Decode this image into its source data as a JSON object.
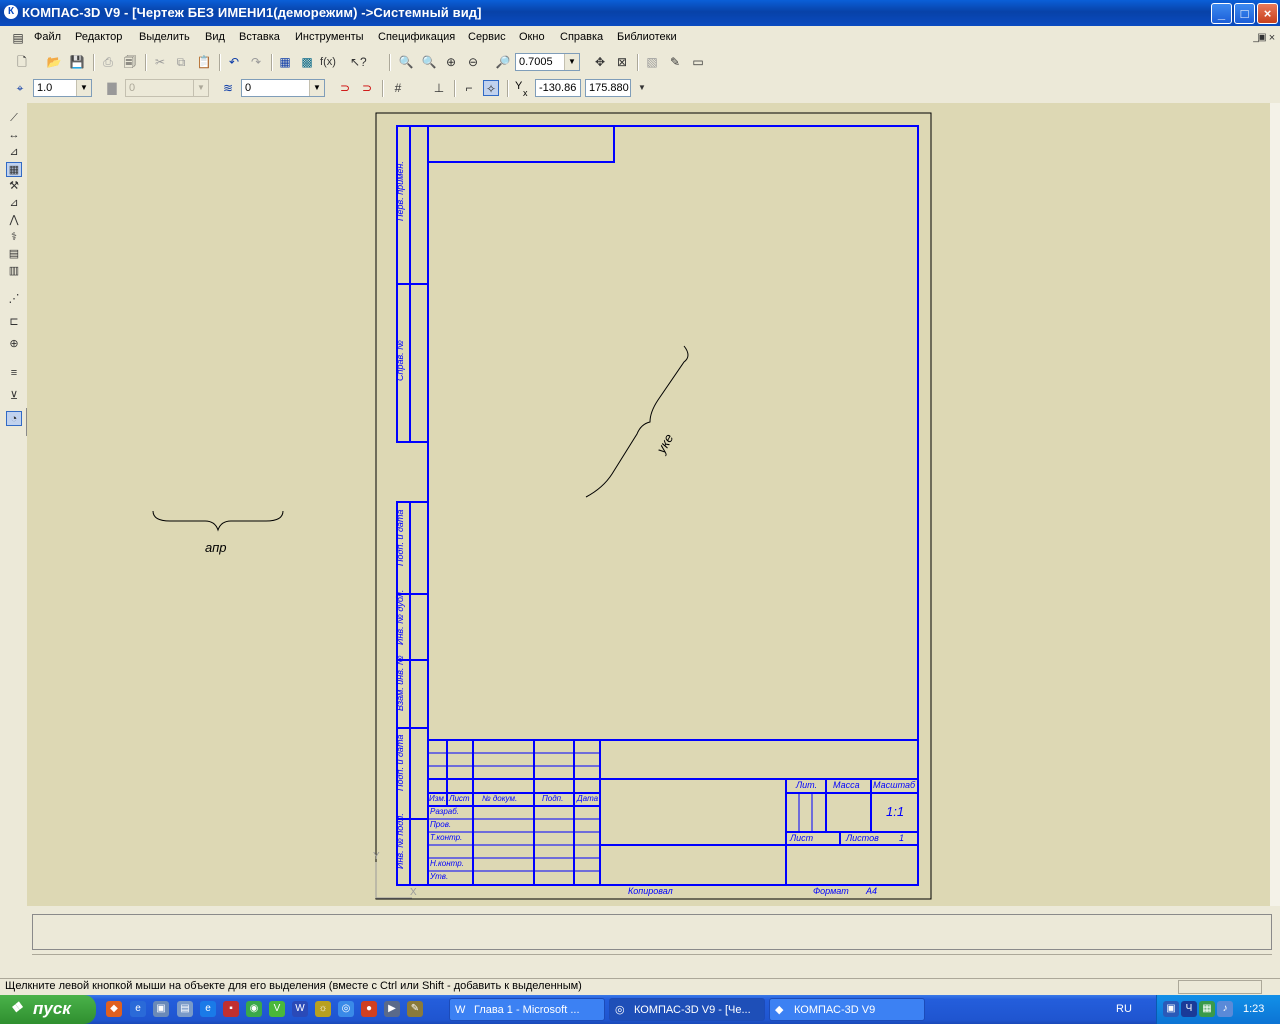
{
  "window": {
    "title": "КОМПАС-3D V9 - [Чертеж БЕЗ ИМЕНИ1(деморежим) ->Системный вид]",
    "controls": [
      "_",
      "□",
      "×"
    ]
  },
  "menu": [
    "Файл",
    "Редактор",
    "Выделить",
    "Вид",
    "Вставка",
    "Инструменты",
    "Спецификация",
    "Сервис",
    "Окно",
    "Справка",
    "Библиотеки"
  ],
  "toolbar1": {
    "zoom_value": "0.7005",
    "fx_label": "f(x)"
  },
  "toolbar2": {
    "step_value": "1.0",
    "layer_disabled_value": "0",
    "style_value": "0",
    "coord_y_label": "Y",
    "coord_x_label": "x",
    "coord_x_value": "-130.86",
    "coord_y_value": "175.880"
  },
  "drawing": {
    "left_labels": [
      "Перв. примен.",
      "Справ. №",
      "Подп. и дата",
      "Инв. № дубл.",
      "Взам. инв. №",
      "Подп. и дата",
      "Инв. № подл."
    ],
    "title_block": {
      "header_cols": [
        "Изм.",
        "Лист",
        "№ докум.",
        "Подп.",
        "Дата"
      ],
      "rows": [
        "Разраб.",
        "Пров.",
        "Т.контр.",
        "Н.контр.",
        "Утв."
      ],
      "lit_label": "Лит.",
      "mass_label": "Масса",
      "scale_label": "Масштаб",
      "scale_value": "1:1",
      "sheet_label": "Лист",
      "sheets_label": "Листов",
      "sheets_value": "1"
    },
    "bottom_left": "Копировал",
    "format_label": "Формат",
    "format_value": "A4",
    "axis_y": "Y",
    "axis_x": "X",
    "annotation_diag": "уке",
    "annotation_brace": "апр"
  },
  "status_text": "Щелкните левой кнопкой мыши на объекте для его выделения (вместе с Ctrl или Shift - добавить к выделенным)",
  "taskbar": {
    "start_label": "пуск",
    "tasks": [
      "Глава 1 - Microsoft ...",
      "КОМПАС-3D V9 - [Че...",
      "КОМПАС-3D V9"
    ],
    "lang": "RU",
    "time": "1:23"
  },
  "colors": {
    "drawing_line": "#0000ff",
    "workspace_bg": "#ddd8b4",
    "titlebar": "#0842a8"
  }
}
